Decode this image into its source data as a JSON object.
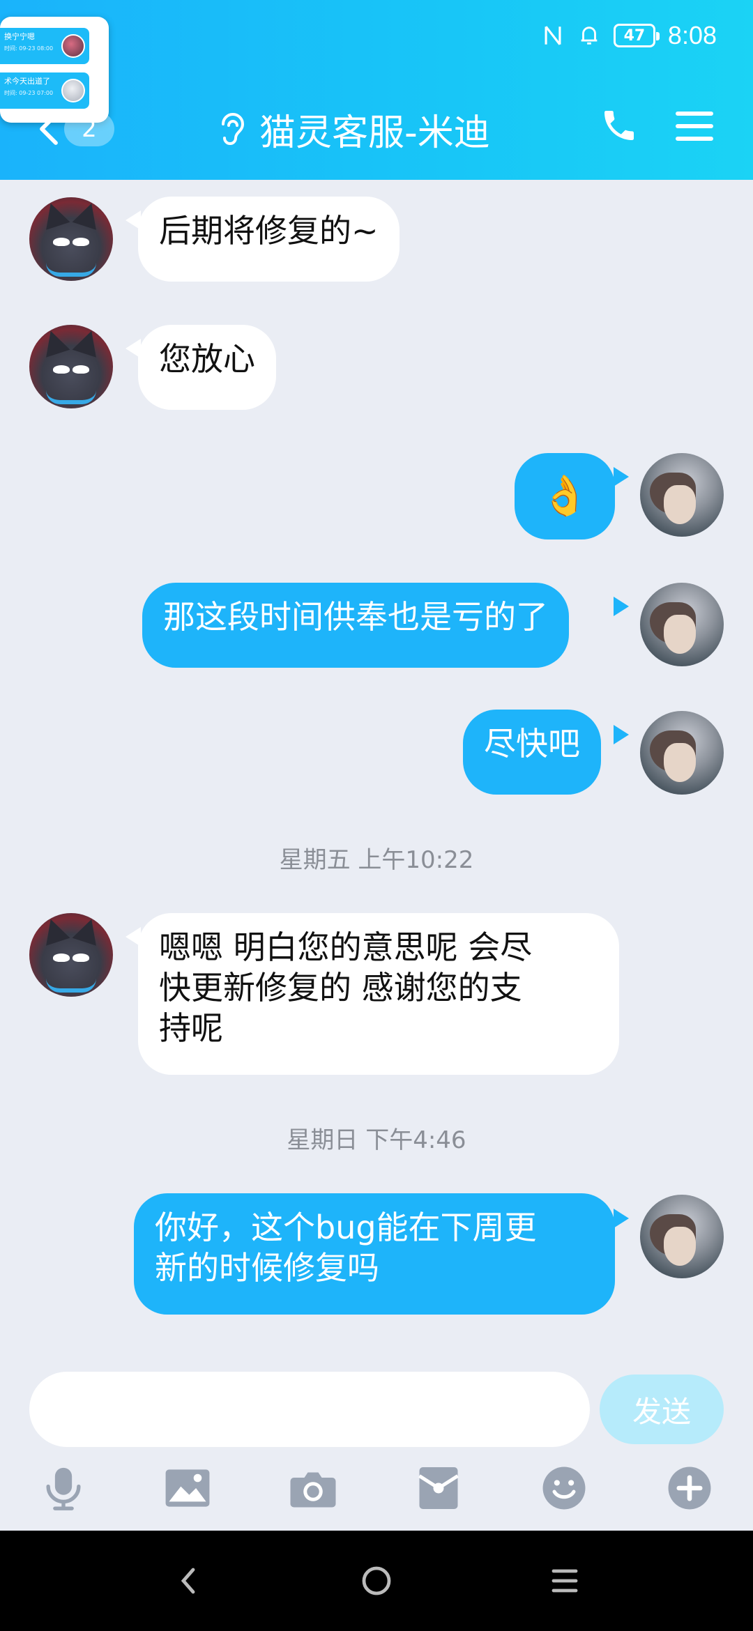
{
  "status_bar": {
    "time": "8:08",
    "battery": "47"
  },
  "notifications": [
    {
      "text": "换宁宁嗯",
      "time": "时间: 09-23 08:00"
    },
    {
      "text": "术今天出道了",
      "time": "时间: 09-23 07:00"
    }
  ],
  "header": {
    "unread_badge": "2",
    "title": "猫灵客服-米迪"
  },
  "messages": [
    {
      "side": "in",
      "text": "后期将修复的~"
    },
    {
      "side": "in",
      "text": "您放心"
    },
    {
      "side": "out",
      "emoji": "👌"
    },
    {
      "side": "out",
      "text": "那这段时间供奉也是亏的了"
    },
    {
      "side": "out",
      "text": "尽快吧"
    },
    {
      "timestamp": "星期五 上午10:22"
    },
    {
      "side": "in",
      "text_lines": [
        "嗯嗯 明白您的意思呢 会尽",
        "快更新修复的 感谢您的支",
        "持呢"
      ]
    },
    {
      "timestamp": "星期日 下午4:46"
    },
    {
      "side": "out",
      "text_lines": [
        "你好，这个bug能在下周更",
        "新的时候修复吗"
      ]
    }
  ],
  "input": {
    "placeholder": "",
    "send_label": "发送"
  },
  "toolbar_icons": [
    "microphone-icon",
    "image-icon",
    "camera-icon",
    "red-packet-icon",
    "emoji-icon",
    "plus-icon"
  ],
  "colors": {
    "header_start": "#1ab3fb",
    "header_end": "#1bd3f5",
    "bubble_out": "#1eb4fa",
    "bubble_in": "#ffffff",
    "background": "#eaedf4",
    "send_disabled": "#b6ebfb"
  }
}
